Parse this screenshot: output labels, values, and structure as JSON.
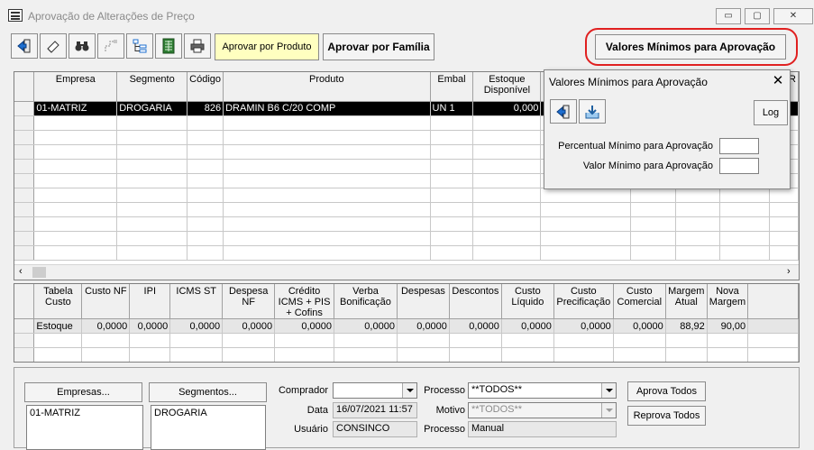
{
  "window": {
    "title": "Aprovação de Alterações de Preço",
    "minimize": "▭",
    "maximize": "▢",
    "close": "✕"
  },
  "toolbar": {
    "icons": [
      "exit-icon",
      "eraser-icon",
      "binoculars-icon",
      "tree-icon",
      "hierarchy-icon",
      "spreadsheet-icon",
      "printer-icon"
    ],
    "aprovar_produto": "Aprovar por Produto",
    "aprovar_familia": "Aprovar por Família",
    "valores_minimos": "Valores Mínimos para Aprovação"
  },
  "main_grid": {
    "columns": [
      "Empresa",
      "Segmento",
      "Código",
      "Produto",
      "Embal",
      "Estoque Disponível"
    ],
    "rows": [
      [
        "01-MATRIZ",
        "DROGARIA",
        "826",
        "DRAMIN B6 C/20 COMP",
        "UN  1",
        "0,000"
      ]
    ],
    "right_header_fragment": "R"
  },
  "cost_grid": {
    "columns": [
      "Tabela Custo",
      "Custo NF",
      "IPI",
      "ICMS ST",
      "Despesa NF",
      "Crédito ICMS + PIS + Cofins",
      "Verba Bonificação",
      "Despesas",
      "Descontos",
      "Custo Líquido",
      "Custo Precificação",
      "Custo Comercial",
      "Margem Atual",
      "Nova Margem"
    ],
    "rows": [
      [
        "Estoque",
        "0,0000",
        "0,0000",
        "0,0000",
        "0,0000",
        "0,0000",
        "0,0000",
        "0,0000",
        "0,0000",
        "0,0000",
        "0,0000",
        "0,0000",
        "88,92",
        "90,00"
      ]
    ]
  },
  "bottom": {
    "empresas_button": "Empresas...",
    "segmentos_button": "Segmentos...",
    "empresas_list": [
      "01-MATRIZ"
    ],
    "segmentos_list": [
      "DROGARIA"
    ],
    "comprador_label": "Comprador",
    "comprador_value": "",
    "data_label": "Data",
    "data_value": "16/07/2021 11:57",
    "usuario_label": "Usuário",
    "usuario_value": "CONSINCO",
    "processo_label": "Processo",
    "processo_value": "**TODOS**",
    "motivo_label": "Motivo",
    "motivo_value": "**TODOS**",
    "processo2_label": "Processo",
    "processo2_value": "Manual",
    "aprova_todos": "Aprova Todos",
    "reprova_todos": "Reprova Todos"
  },
  "dialog": {
    "title": "Valores Mínimos para Aprovação",
    "close": "✕",
    "log_button": "Log",
    "percentual_label": "Percentual Mínimo para Aprovação",
    "percentual_value": "",
    "valor_label": "Valor Mínimo para Aprovação",
    "valor_value": ""
  },
  "colors": {
    "highlight": "#ffffc0",
    "annotation": "#e02020",
    "selected_row": "#000000"
  }
}
